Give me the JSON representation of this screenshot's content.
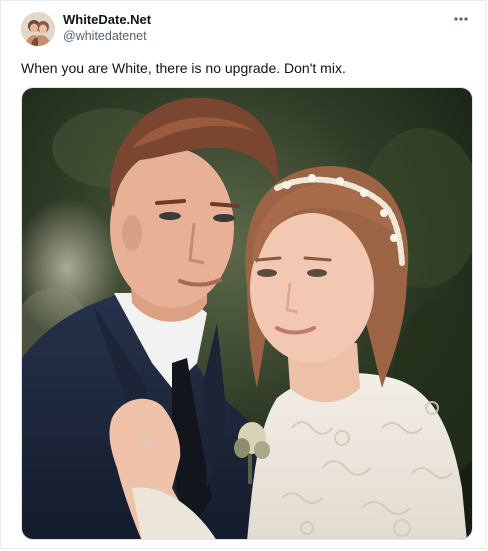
{
  "tweet": {
    "display_name": "WhiteDate.Net",
    "handle": "@whitedatenet",
    "text": "When you are White, there is no upgrade. Don't mix.",
    "icons": {
      "avatar": "avatar-photo",
      "more": "more-options-icon",
      "media": "wedding-couple-photo"
    }
  },
  "colors": {
    "text_primary": "#0f1419",
    "text_secondary": "#536471",
    "border": "#e6ecf0"
  }
}
